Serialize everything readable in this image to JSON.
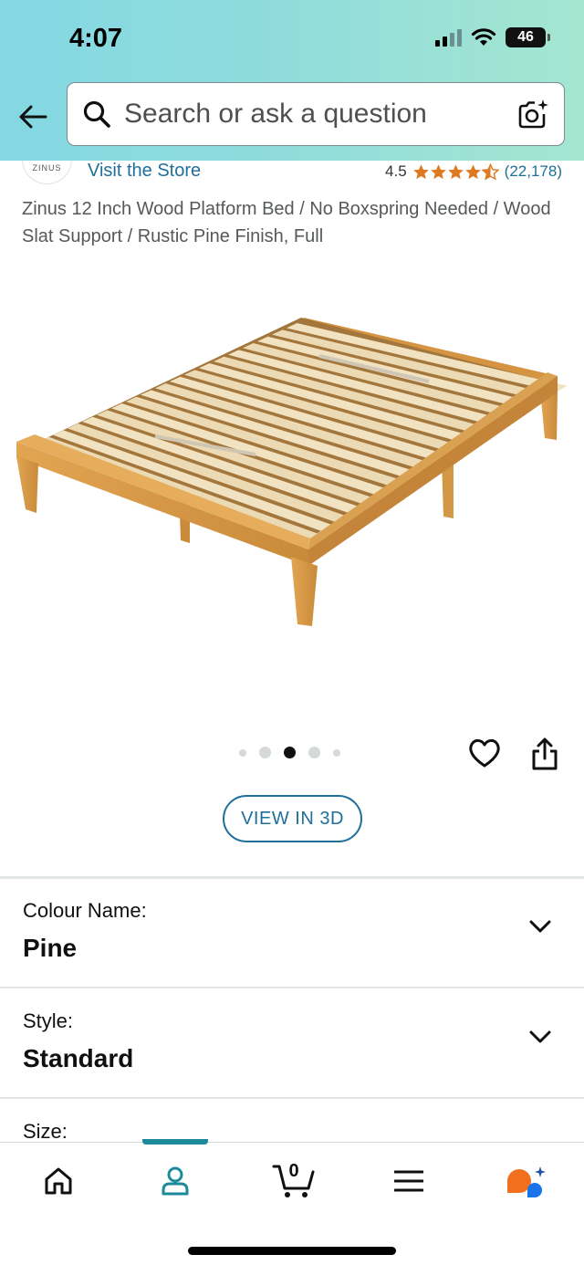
{
  "status_bar": {
    "time": "4:07",
    "battery": "46"
  },
  "search": {
    "placeholder": "Search or ask a question"
  },
  "store": {
    "logo_text": "ZINUS",
    "link_label": "Visit the Store"
  },
  "rating": {
    "value": "4.5",
    "stars": 4.5,
    "review_count": "(22,178)"
  },
  "product": {
    "title": "Zinus 12 Inch Wood Platform Bed / No Boxspring Needed / Wood Slat Support / Rustic Pine Finish, Full",
    "image_count": 5,
    "active_image_index": 2
  },
  "view3d": {
    "label": "VIEW IN 3D"
  },
  "options": [
    {
      "label": "Colour Name:",
      "value": "Pine"
    },
    {
      "label": "Style:",
      "value": "Standard"
    },
    {
      "label": "Size:",
      "value": ""
    }
  ],
  "bottom_nav": {
    "items": [
      "home-icon",
      "account-icon",
      "cart-icon",
      "menu-icon",
      "rufus-icon"
    ],
    "active_item": "account-icon",
    "cart_count": "0"
  },
  "colors": {
    "header_gradient_start": "#84d8e3",
    "header_gradient_end": "#a4e6d0",
    "link": "#1f6f9a",
    "star": "#de7921",
    "active_nav": "#1b8a9a",
    "wood": "#d99a45",
    "slat": "#efe0bf"
  }
}
